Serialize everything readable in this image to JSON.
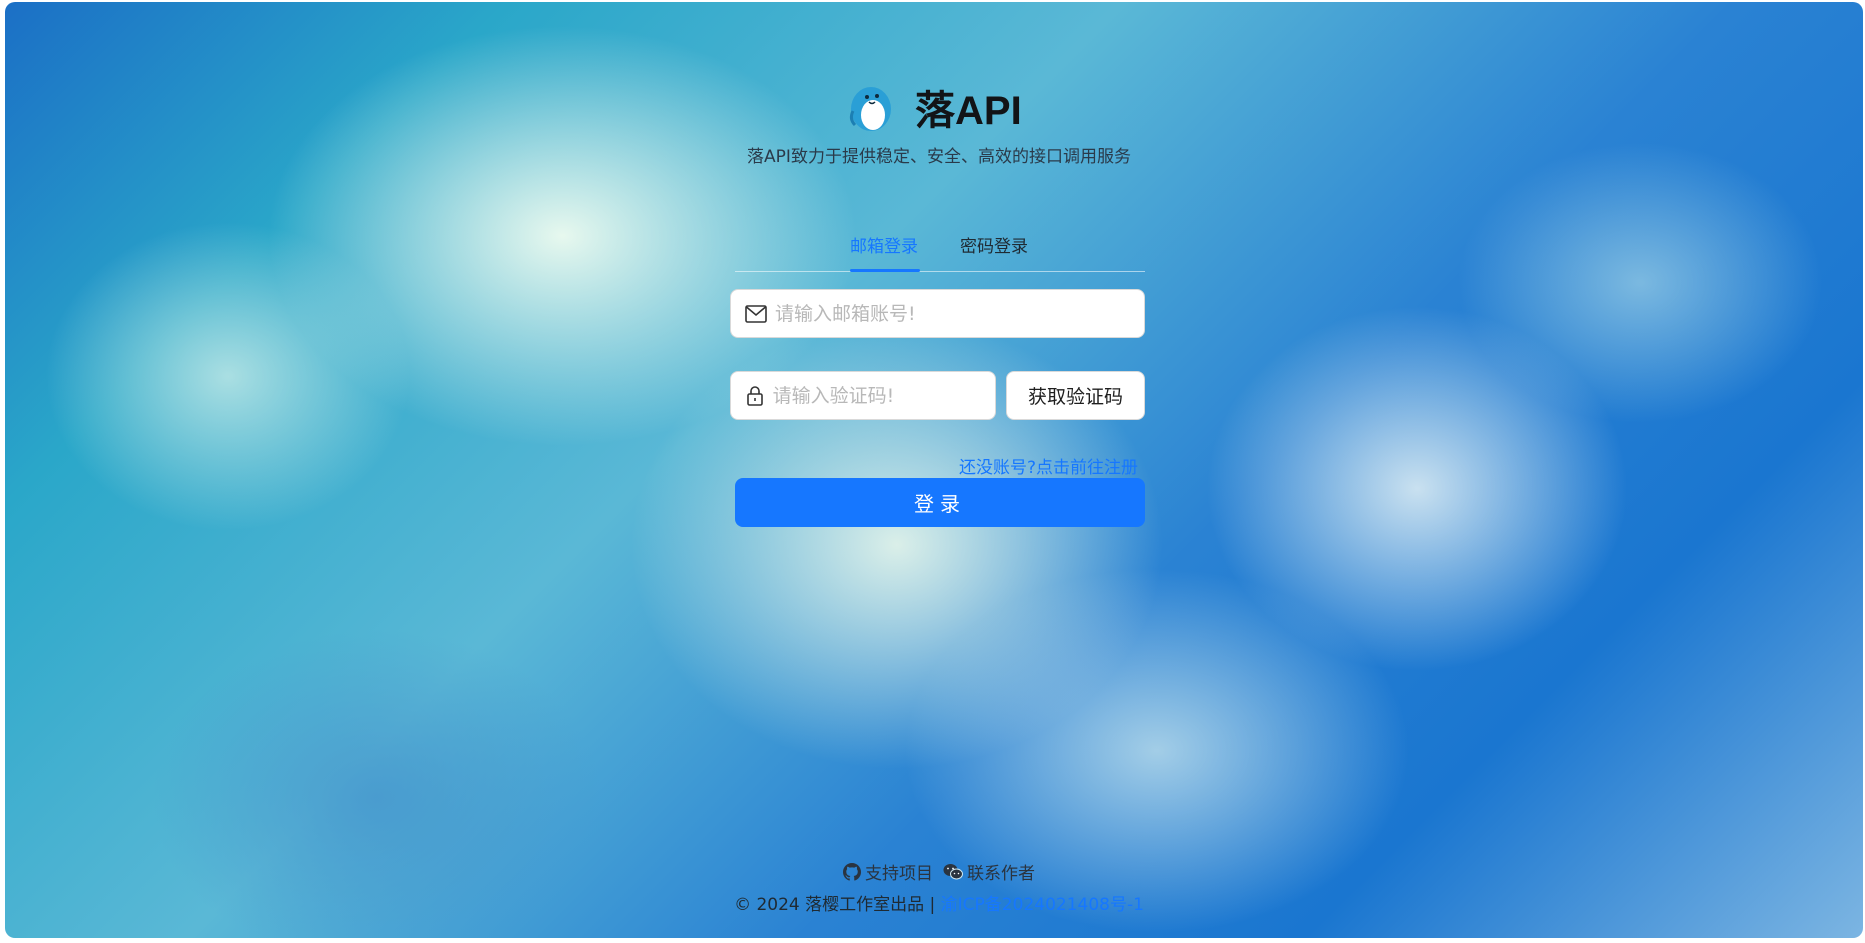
{
  "brand": {
    "title": "落API",
    "subtitle": "落API致力于提供稳定、安全、高效的接口调用服务"
  },
  "tabs": [
    {
      "label": "邮箱登录",
      "active": true
    },
    {
      "label": "密码登录",
      "active": false
    }
  ],
  "form": {
    "email_placeholder": "请输入邮箱账号!",
    "code_placeholder": "请输入验证码!",
    "get_code_label": "获取验证码",
    "register_link": "还没账号?点击前往注册",
    "login_label": "登录"
  },
  "footer": {
    "support_label": "支持项目",
    "contact_label": "联系作者",
    "copyright": "© 2024 落樱工作室出品 | ",
    "icp": "渝ICP备2024021408号-1"
  },
  "colors": {
    "accent": "#1677ff"
  },
  "icons": {
    "email": "mail-icon",
    "code": "lock-icon",
    "github": "github-icon",
    "wechat": "wechat-icon"
  }
}
